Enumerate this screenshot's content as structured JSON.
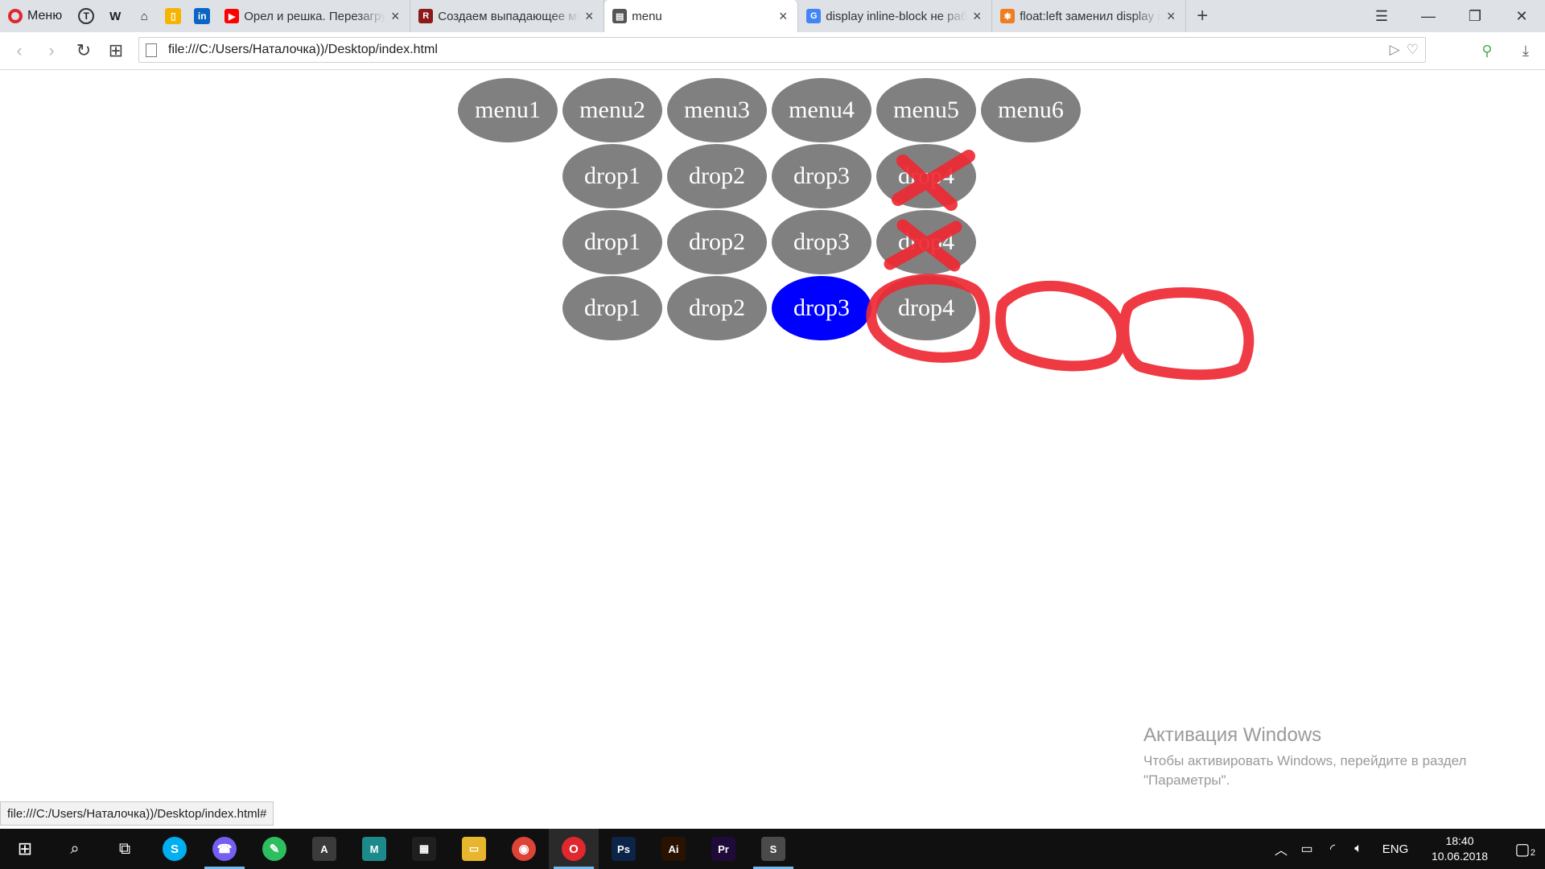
{
  "browser": {
    "menu_label": "Меню",
    "pinned": [
      {
        "icon": "circle-t-icon",
        "glyph": "T"
      },
      {
        "icon": "wikipedia-icon",
        "glyph": "W"
      },
      {
        "icon": "github-icon",
        "glyph": "⌂"
      },
      {
        "icon": "bookmark-icon",
        "glyph": "▯"
      },
      {
        "icon": "linkedin-icon",
        "glyph": "in"
      }
    ],
    "tabs": [
      {
        "title": "Орел и решка. Перезагрузка",
        "favicon": "youtube-icon",
        "glyph": "▶",
        "color": "#ff0000",
        "active": false
      },
      {
        "title": "Создаем выпадающее меню",
        "favicon": "r-icon",
        "glyph": "R",
        "color": "#8b1a1a",
        "active": false
      },
      {
        "title": "menu",
        "favicon": "document-icon",
        "glyph": "▤",
        "color": "#555555",
        "active": true
      },
      {
        "title": "display inline-block не работает",
        "favicon": "google-icon",
        "glyph": "G",
        "color": "#4285f4",
        "active": false
      },
      {
        "title": "float:left заменил display inline-block",
        "favicon": "joomla-icon",
        "glyph": "✱",
        "color": "#f07d1f",
        "active": false
      }
    ],
    "url": "file:///C:/Users/Наталочка))/Desktop/index.html"
  },
  "menu": {
    "top": [
      "menu1",
      "menu2",
      "menu3",
      "menu4",
      "menu5",
      "menu6"
    ],
    "rows": [
      [
        "drop1",
        "drop2",
        "drop3",
        "drop4"
      ],
      [
        "drop1",
        "drop2",
        "drop3",
        "drop4"
      ],
      [
        "drop1",
        "drop2",
        "drop3",
        "drop4"
      ]
    ],
    "highlighted": {
      "row": 2,
      "col": 2
    },
    "colors": {
      "item": "#808080",
      "highlight": "#0000ff",
      "text": "#ffffff",
      "annotation": "#ee2a35"
    }
  },
  "status_url": "file:///C:/Users/Наталочка))/Desktop/index.html#",
  "watermark": {
    "title": "Активация Windows",
    "line": "Чтобы активировать Windows, перейдите в раздел \"Параметры\"."
  },
  "taskbar": {
    "apps": [
      {
        "name": "skype",
        "glyph": "S",
        "color": "#00aff0",
        "shape": "round"
      },
      {
        "name": "viber",
        "glyph": "☎",
        "color": "#7360f2",
        "shape": "round",
        "running": true
      },
      {
        "name": "evernote",
        "glyph": "✎",
        "color": "#2dbe60",
        "shape": "round"
      },
      {
        "name": "autocad",
        "glyph": "A",
        "color": "#3b3b3b",
        "shape": "tile"
      },
      {
        "name": "maya",
        "glyph": "M",
        "color": "#1c8a8a",
        "shape": "tile"
      },
      {
        "name": "store",
        "glyph": "▦",
        "color": "#1f1f1f",
        "shape": "tile"
      },
      {
        "name": "explorer",
        "glyph": "▭",
        "color": "#e8b62c",
        "shape": "tile"
      },
      {
        "name": "chrome",
        "glyph": "◉",
        "color": "#db4437",
        "shape": "round"
      },
      {
        "name": "opera",
        "glyph": "O",
        "color": "#e0282e",
        "shape": "round",
        "running": true,
        "active": true
      },
      {
        "name": "photoshop",
        "glyph": "Ps",
        "color": "#0b2447",
        "shape": "tile"
      },
      {
        "name": "illustrator",
        "glyph": "Ai",
        "color": "#2a1200",
        "shape": "tile"
      },
      {
        "name": "premiere",
        "glyph": "Pr",
        "color": "#1f0a3a",
        "shape": "tile"
      },
      {
        "name": "sublime",
        "glyph": "S",
        "color": "#4a4a4a",
        "shape": "tile",
        "running": true
      }
    ],
    "lang": "ENG",
    "time": "18:40",
    "date": "10.06.2018",
    "notifications": "2"
  }
}
